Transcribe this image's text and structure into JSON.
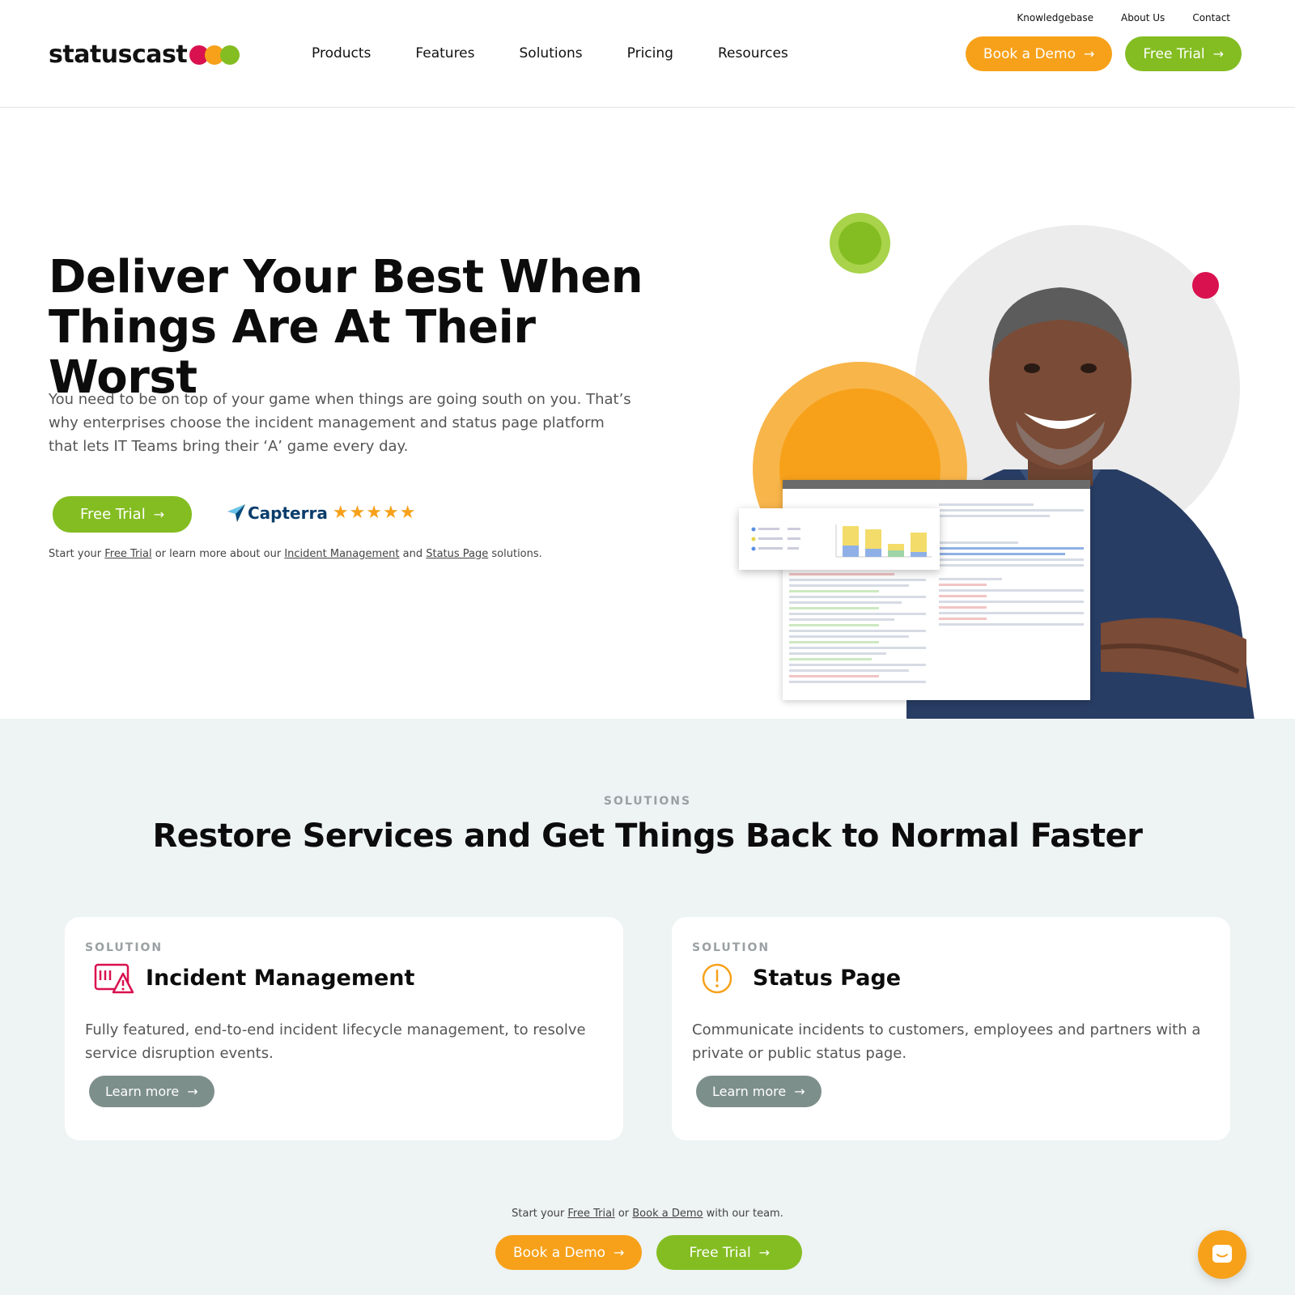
{
  "header": {
    "logo_text": "statuscast",
    "utility_nav": [
      "Knowledgebase",
      "About Us",
      "Contact"
    ],
    "main_nav": [
      "Products",
      "Features",
      "Solutions",
      "Pricing",
      "Resources"
    ],
    "book_demo": "Book a Demo",
    "free_trial": "Free Trial"
  },
  "hero": {
    "headline_part1": "Deliver Your ",
    "headline_highlight1": "Best",
    "headline_part2": " When Things Are At Their ",
    "headline_highlight2": "Worst",
    "description": "You need to be on top of your game when things are going south on you. That’s why enterprises choose the incident management and status page platform that lets IT Teams bring their ‘A’ game every day.",
    "free_trial": "Free Trial",
    "capterra_name": "Capterra",
    "capterra_stars": "★★★★★",
    "footnote_prefix": "Start your ",
    "footnote_link1": "Free Trial",
    "footnote_mid1": " or learn more about our ",
    "footnote_link2": "Incident Management",
    "footnote_mid2": " and ",
    "footnote_link3": "Status Page",
    "footnote_suffix": " solutions."
  },
  "solutions": {
    "eyebrow": "SOLUTIONS",
    "title": "Restore Services and Get Things Back to Normal Faster",
    "cards": [
      {
        "eyebrow": "SOLUTION",
        "icon": "incident-alert-icon",
        "title": "Incident Management",
        "description": "Fully featured, end-to-end incident lifecycle management, to resolve service disruption events.",
        "button": "Learn more"
      },
      {
        "eyebrow": "SOLUTION",
        "icon": "exclamation-circle-icon",
        "title": "Status Page",
        "description": "Communicate incidents to customers, employees and partners with a private or public status page.",
        "button": "Learn more"
      }
    ],
    "footnote_prefix": "Start your ",
    "footnote_link1": "Free Trial",
    "footnote_mid": " or ",
    "footnote_link2": "Book a Demo",
    "footnote_suffix": " with our team.",
    "book_demo": "Book a Demo",
    "free_trial": "Free Trial"
  },
  "colors": {
    "orange": "#f7a11a",
    "green": "#84bd22",
    "red": "#d9114f",
    "slate": "#7d8f8b"
  }
}
